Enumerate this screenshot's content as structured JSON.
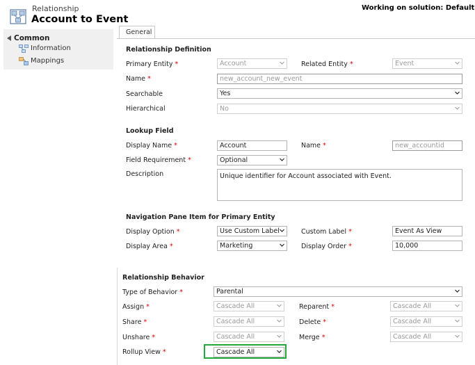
{
  "header": {
    "entity_type": "Relationship",
    "title": "Account to Event",
    "solution": "Working on solution: Default Solut"
  },
  "nav": {
    "section": "Common",
    "items": [
      {
        "label": "Information",
        "icon": "information-icon"
      },
      {
        "label": "Mappings",
        "icon": "mappings-icon"
      }
    ]
  },
  "tabs": {
    "general": "General"
  },
  "relationship_definition": {
    "title": "Relationship Definition",
    "primary_entity": {
      "label": "Primary Entity",
      "value": "Account"
    },
    "related_entity": {
      "label": "Related Entity",
      "value": "Event"
    },
    "name": {
      "label": "Name",
      "value": "new_account_new_event"
    },
    "searchable": {
      "label": "Searchable",
      "value": "Yes"
    },
    "hierarchical": {
      "label": "Hierarchical",
      "value": "No"
    }
  },
  "lookup_field": {
    "title": "Lookup Field",
    "display_name": {
      "label": "Display Name",
      "value": "Account"
    },
    "name": {
      "label": "Name",
      "value": "new_accountid"
    },
    "field_requirement": {
      "label": "Field Requirement",
      "value": "Optional"
    },
    "description": {
      "label": "Description",
      "value": "Unique identifier for Account associated with Event."
    }
  },
  "navigation_pane": {
    "title": "Navigation Pane Item for Primary Entity",
    "display_option": {
      "label": "Display Option",
      "value": "Use Custom Label"
    },
    "custom_label": {
      "label": "Custom Label",
      "value": "Event As View"
    },
    "display_area": {
      "label": "Display Area",
      "value": "Marketing"
    },
    "display_order": {
      "label": "Display Order",
      "value": "10,000"
    }
  },
  "relationship_behavior": {
    "title": "Relationship Behavior",
    "type_of_behavior": {
      "label": "Type of Behavior",
      "value": "Parental"
    },
    "assign": {
      "label": "Assign",
      "value": "Cascade All"
    },
    "reparent": {
      "label": "Reparent",
      "value": "Cascade All"
    },
    "share": {
      "label": "Share",
      "value": "Cascade All"
    },
    "delete": {
      "label": "Delete",
      "value": "Cascade All"
    },
    "unshare": {
      "label": "Unshare",
      "value": "Cascade All"
    },
    "merge": {
      "label": "Merge",
      "value": "Cascade All"
    },
    "rollup_view": {
      "label": "Rollup View",
      "value": "Cascade All"
    }
  },
  "colors": {
    "required": "#dd0000",
    "highlight": "#22a83a",
    "nav_bg": "#f0f0f0"
  }
}
